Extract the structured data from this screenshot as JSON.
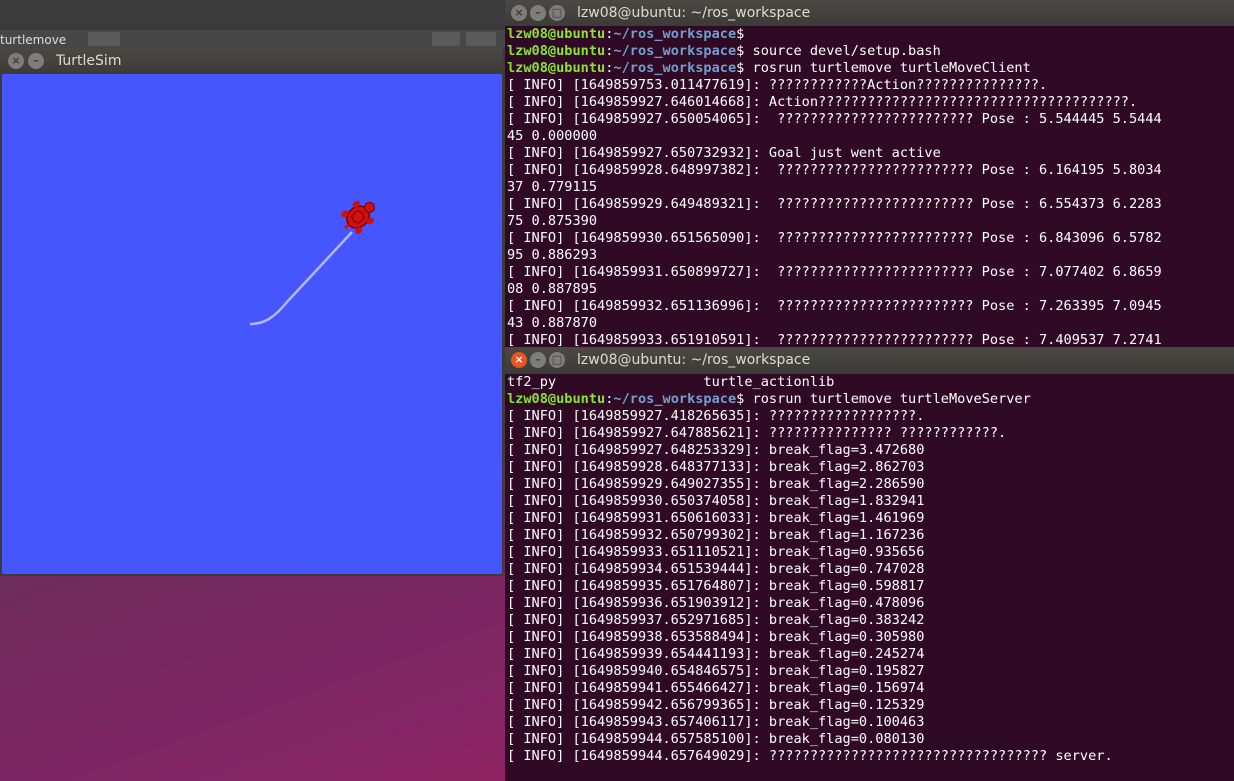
{
  "desktop": {
    "background_label": "turtlemove",
    "colors": {
      "top": "#3b3b3b",
      "bottom": "#8a2460"
    }
  },
  "turtlesim": {
    "title": "TurtleSim",
    "background": "#4556ff",
    "path_color": "#b3b8ff",
    "turtle_color": "#d01010"
  },
  "term1": {
    "title": "lzw08@ubuntu: ~/ros_workspace",
    "lines": [
      {
        "user": "lzw08@ubuntu",
        "path": "~/ros_workspace",
        "cmd": ""
      },
      {
        "user": "lzw08@ubuntu",
        "path": "~/ros_workspace",
        "cmd": " source devel/setup.bash"
      },
      {
        "user": "lzw08@ubuntu",
        "path": "~/ros_workspace",
        "cmd": " rosrun turtlemove turtleMoveClient"
      },
      {
        "text": "[ INFO] [1649859753.011477619]: ????????????Action???????????????."
      },
      {
        "text": "[ INFO] [1649859927.646014668]: Action??????????????????????????????????????."
      },
      {
        "text": "[ INFO] [1649859927.650054065]:  ???????????????????????? Pose : 5.544445 5.5444"
      },
      {
        "text": "45 0.000000"
      },
      {
        "text": "[ INFO] [1649859927.650732932]: Goal just went active"
      },
      {
        "text": "[ INFO] [1649859928.648997382]:  ???????????????????????? Pose : 6.164195 5.8034"
      },
      {
        "text": "37 0.779115"
      },
      {
        "text": "[ INFO] [1649859929.649489321]:  ???????????????????????? Pose : 6.554373 6.2283"
      },
      {
        "text": "75 0.875390"
      },
      {
        "text": "[ INFO] [1649859930.651565090]:  ???????????????????????? Pose : 6.843096 6.5782"
      },
      {
        "text": "95 0.886293"
      },
      {
        "text": "[ INFO] [1649859931.650899727]:  ???????????????????????? Pose : 7.077402 6.8659"
      },
      {
        "text": "08 0.887895"
      },
      {
        "text": "[ INFO] [1649859932.651136996]:  ???????????????????????? Pose : 7.263395 7.0945"
      },
      {
        "text": "43 0.887870"
      },
      {
        "text": "[ INFO] [1649859933.651910591]:  ???????????????????????? Pose : 7.409537 7.2741"
      }
    ]
  },
  "term2": {
    "title": "lzw08@ubuntu: ~/ros_workspace",
    "lines": [
      {
        "text": "tf2_py                  turtle_actionlib"
      },
      {
        "user": "lzw08@ubuntu",
        "path": "~/ros_workspace",
        "cmd": " rosrun turtlemove turtleMoveServer"
      },
      {
        "text": "[ INFO] [1649859927.418265635]: ??????????????????."
      },
      {
        "text": "[ INFO] [1649859927.647885621]: ??????????????? ????????????."
      },
      {
        "text": "[ INFO] [1649859927.648253329]: break_flag=3.472680"
      },
      {
        "text": "[ INFO] [1649859928.648377133]: break_flag=2.862703"
      },
      {
        "text": "[ INFO] [1649859929.649027355]: break_flag=2.286590"
      },
      {
        "text": "[ INFO] [1649859930.650374058]: break_flag=1.832941"
      },
      {
        "text": "[ INFO] [1649859931.650616033]: break_flag=1.461969"
      },
      {
        "text": "[ INFO] [1649859932.650799302]: break_flag=1.167236"
      },
      {
        "text": "[ INFO] [1649859933.651110521]: break_flag=0.935656"
      },
      {
        "text": "[ INFO] [1649859934.651539444]: break_flag=0.747028"
      },
      {
        "text": "[ INFO] [1649859935.651764807]: break_flag=0.598817"
      },
      {
        "text": "[ INFO] [1649859936.651903912]: break_flag=0.478096"
      },
      {
        "text": "[ INFO] [1649859937.652971685]: break_flag=0.383242"
      },
      {
        "text": "[ INFO] [1649859938.653588494]: break_flag=0.305980"
      },
      {
        "text": "[ INFO] [1649859939.654441193]: break_flag=0.245274"
      },
      {
        "text": "[ INFO] [1649859940.654846575]: break_flag=0.195827"
      },
      {
        "text": "[ INFO] [1649859941.655466427]: break_flag=0.156974"
      },
      {
        "text": "[ INFO] [1649859942.656799365]: break_flag=0.125329"
      },
      {
        "text": "[ INFO] [1649859943.657406117]: break_flag=0.100463"
      },
      {
        "text": "[ INFO] [1649859944.657585100]: break_flag=0.080130"
      },
      {
        "text": "[ INFO] [1649859944.657649029]: ?????????????????????????????????? server."
      }
    ]
  },
  "icons": {
    "close": "close-icon",
    "minimize": "minimize-icon",
    "maximize": "maximize-icon"
  }
}
